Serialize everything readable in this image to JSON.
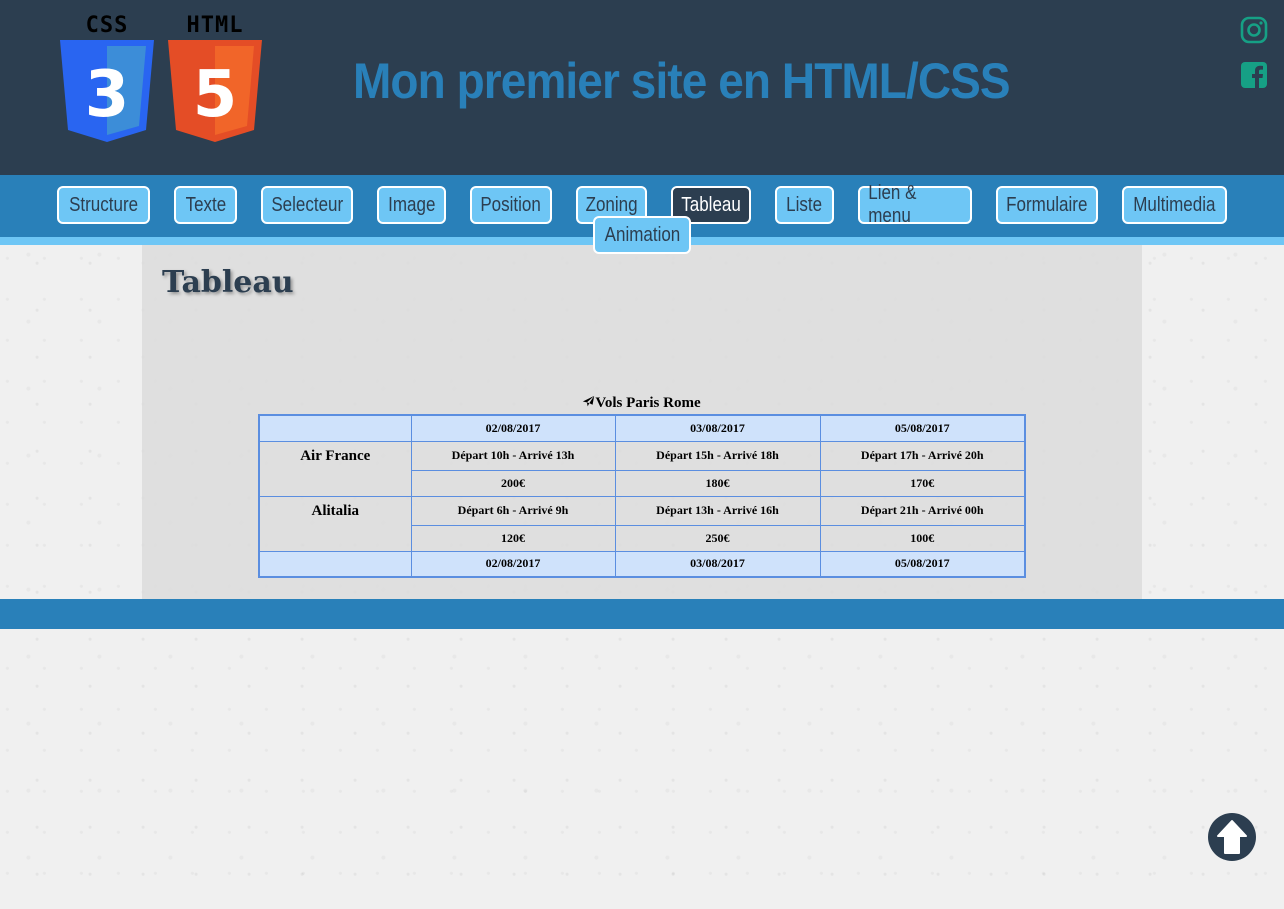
{
  "header": {
    "logos": [
      {
        "label": "CSS",
        "number": "3",
        "color": "#2965f1",
        "shade": "#3c8dd8"
      },
      {
        "label": "HTML",
        "number": "5",
        "color": "#e44d26",
        "shade": "#f16529"
      }
    ],
    "title": "Mon premier site en HTML/CSS",
    "social_icons": [
      "instagram-icon",
      "facebook-icon"
    ],
    "accent_color": "#2980b9",
    "social_color": "#16a085"
  },
  "nav": {
    "items": [
      {
        "label": "Structure",
        "active": false
      },
      {
        "label": "Texte",
        "active": false
      },
      {
        "label": "Selecteur",
        "active": false
      },
      {
        "label": "Image",
        "active": false
      },
      {
        "label": "Position",
        "active": false
      },
      {
        "label": "Zoning",
        "active": false
      },
      {
        "label": "Tableau",
        "active": true
      },
      {
        "label": "Liste",
        "active": false
      },
      {
        "label": "Lien & menu",
        "active": false
      },
      {
        "label": "Formulaire",
        "active": false
      },
      {
        "label": "Multimedia",
        "active": false
      },
      {
        "label": "Animation",
        "active": false
      }
    ]
  },
  "main": {
    "title": "Tableau",
    "table": {
      "caption_icon": "plane-icon",
      "caption": "Vols Paris Rome",
      "dates": [
        "02/08/2017",
        "03/08/2017",
        "05/08/2017"
      ],
      "airlines": [
        {
          "name": "Air France",
          "times": [
            "Départ 10h - Arrivé 13h",
            "Départ 15h - Arrivé 18h",
            "Départ 17h - Arrivé 20h"
          ],
          "prices": [
            "200€",
            "180€",
            "170€"
          ]
        },
        {
          "name": "Alitalia",
          "times": [
            "Départ 6h - Arrivé 9h",
            "Départ 13h - Arrivé 16h",
            "Départ 21h - Arrivé 00h"
          ],
          "prices": [
            "120€",
            "250€",
            "100€"
          ]
        }
      ],
      "footer_dates": [
        "02/08/2017",
        "03/08/2017",
        "05/08/2017"
      ]
    }
  },
  "back_to_top_icon": "arrow-up-icon"
}
